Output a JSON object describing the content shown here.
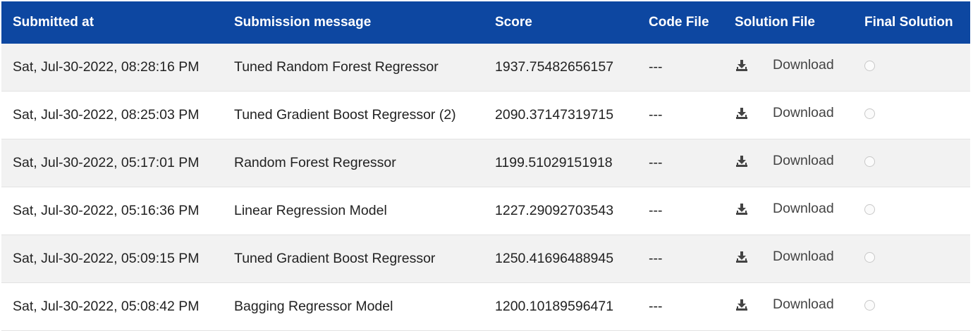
{
  "headers": {
    "submitted_at": "Submitted at",
    "message": "Submission message",
    "score": "Score",
    "code_file": "Code File",
    "solution_file": "Solution File",
    "final_solution": "Final Solution"
  },
  "colors": {
    "header_bg": "#0d47a1",
    "row_alt_bg": "#f2f2f2"
  },
  "icons": {
    "download": "download-icon",
    "final_radio": "radio-unchecked-icon"
  },
  "rows": [
    {
      "submitted_at": "Sat, Jul-30-2022, 08:28:16 PM",
      "message": "Tuned Random Forest Regressor",
      "score": "1937.75482656157",
      "code_file": "---",
      "download_label": "Download"
    },
    {
      "submitted_at": "Sat, Jul-30-2022, 08:25:03 PM",
      "message": "Tuned Gradient Boost Regressor (2)",
      "score": "2090.37147319715",
      "code_file": "---",
      "download_label": "Download"
    },
    {
      "submitted_at": "Sat, Jul-30-2022, 05:17:01 PM",
      "message": "Random Forest Regressor",
      "score": "1199.51029151918",
      "code_file": "---",
      "download_label": "Download"
    },
    {
      "submitted_at": "Sat, Jul-30-2022, 05:16:36 PM",
      "message": "Linear Regression Model",
      "score": "1227.29092703543",
      "code_file": "---",
      "download_label": "Download"
    },
    {
      "submitted_at": "Sat, Jul-30-2022, 05:09:15 PM",
      "message": "Tuned Gradient Boost Regressor",
      "score": "1250.41696488945",
      "code_file": "---",
      "download_label": "Download"
    },
    {
      "submitted_at": "Sat, Jul-30-2022, 05:08:42 PM",
      "message": "Bagging Regressor Model",
      "score": "1200.10189596471",
      "code_file": "---",
      "download_label": "Download"
    }
  ]
}
